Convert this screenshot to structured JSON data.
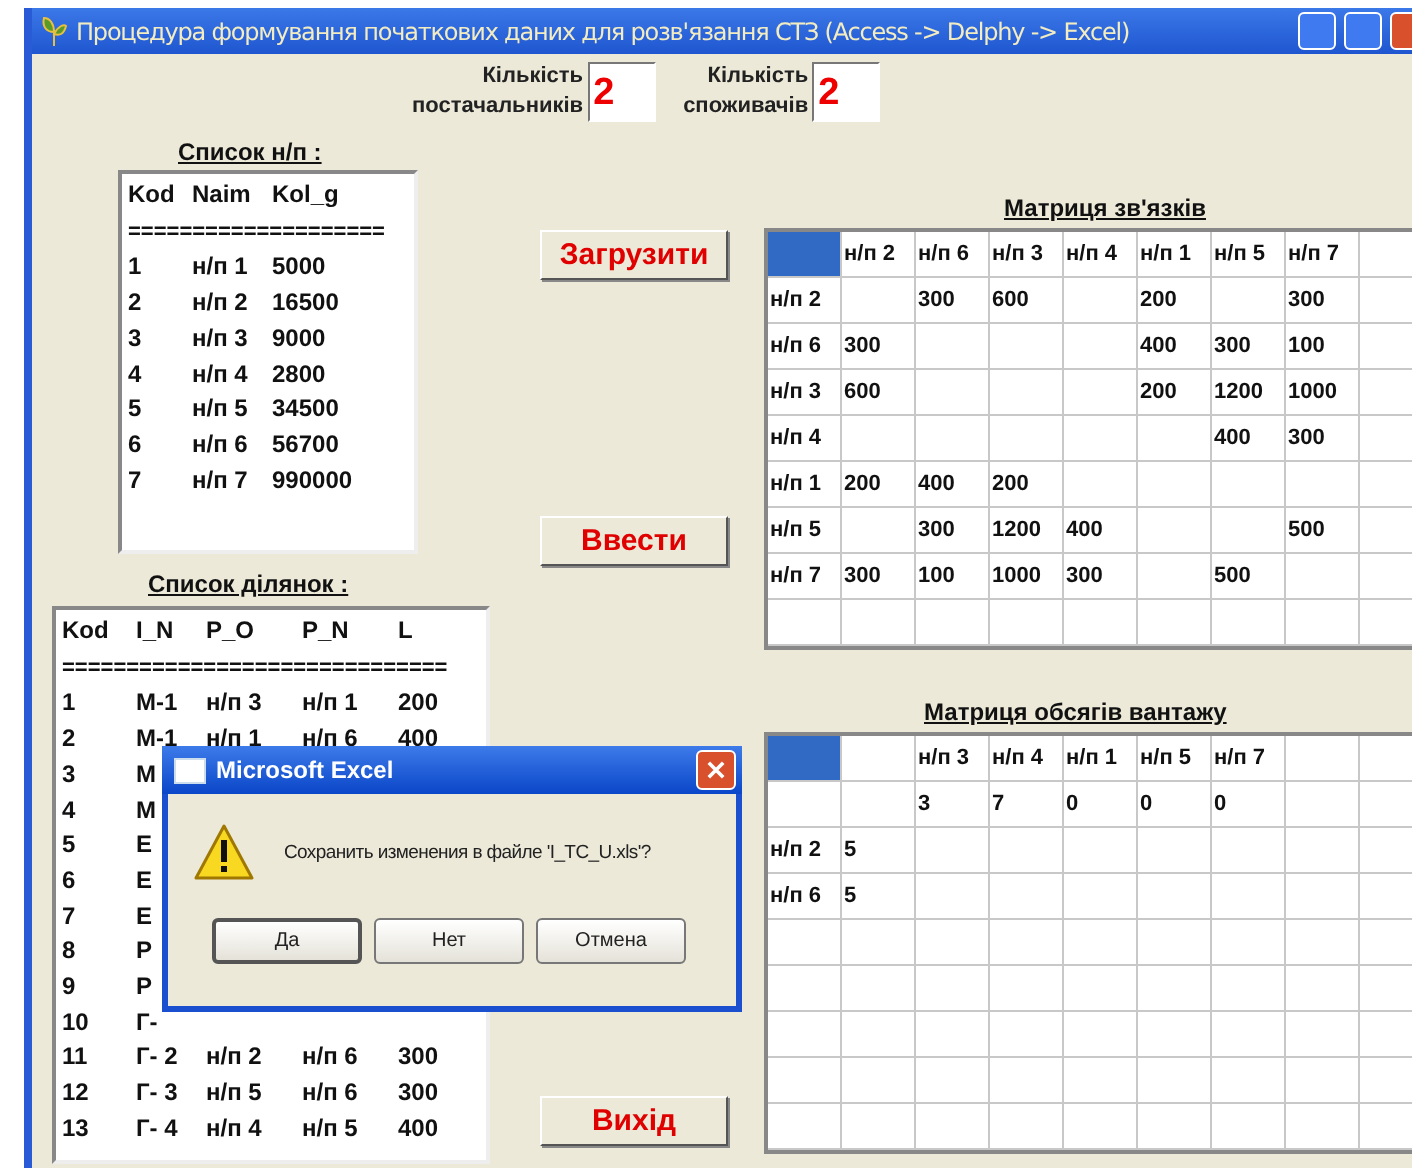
{
  "window": {
    "title": "Процедура формування початкових даних для розв'язання СТЗ (Access -> Delphy -> Excel)"
  },
  "counters": [
    {
      "label_lines": [
        "Кількість",
        "постачальників"
      ],
      "value": "2"
    },
    {
      "label_lines": [
        "Кількість",
        "споживачів"
      ],
      "value": "2"
    }
  ],
  "supplier_list": {
    "title": "Список н/п :",
    "header": [
      "Kod",
      "Naim",
      "Kol_g"
    ],
    "separator": "====================",
    "rows": [
      [
        "1",
        "н/п 1",
        "5000"
      ],
      [
        "2",
        "н/п 2",
        "16500"
      ],
      [
        "3",
        "н/п 3",
        "9000"
      ],
      [
        "4",
        "н/п 4",
        "2800"
      ],
      [
        "5",
        "н/п 5",
        "34500"
      ],
      [
        "6",
        "н/п 6",
        "56700"
      ],
      [
        "7",
        "н/п 7",
        "990000"
      ]
    ]
  },
  "section_list": {
    "title": "Список ділянок :",
    "header": [
      "Kod",
      "I_N",
      "P_O",
      "P_N",
      "L"
    ],
    "separator": "==============================",
    "rows": [
      [
        "1",
        "M-1",
        "н/п 3",
        "н/п 1",
        "200"
      ],
      [
        "2",
        "M-1",
        "н/п 1",
        "н/п 6",
        "400"
      ],
      [
        "3",
        "M"
      ],
      [
        "4",
        "M"
      ],
      [
        "5",
        "E"
      ],
      [
        "6",
        "E"
      ],
      [
        "7",
        "E"
      ],
      [
        "8",
        "P"
      ],
      [
        "9",
        "P"
      ],
      [
        "10",
        "Г-"
      ],
      [
        "11",
        "Г- 2",
        "н/п 2",
        "н/п 6",
        "300"
      ],
      [
        "12",
        "Г- 3",
        "н/п 5",
        "н/п 6",
        "300"
      ],
      [
        "13",
        "Г- 4",
        "н/п 4",
        "н/п 5",
        "400"
      ]
    ]
  },
  "buttons": [
    {
      "label": "Загрузити"
    },
    {
      "label": "Ввести"
    },
    {
      "label": "Вихід"
    }
  ],
  "link_matrix": {
    "title": "Матриця зв'язків",
    "corner_selected": true,
    "rows": [
      [
        null,
        "н/п 2",
        "н/п 6",
        "н/п 3",
        "н/п 4",
        "н/п 1",
        "н/п 5",
        "н/п 7",
        null
      ],
      [
        "н/п 2",
        null,
        "300",
        "600",
        null,
        "200",
        null,
        "300",
        null
      ],
      [
        "н/п 6",
        "300",
        null,
        null,
        null,
        "400",
        "300",
        "100",
        null
      ],
      [
        "н/п 3",
        "600",
        null,
        null,
        null,
        "200",
        "1200",
        "1000",
        null
      ],
      [
        "н/п 4",
        null,
        null,
        null,
        null,
        null,
        "400",
        "300",
        null
      ],
      [
        "н/п 1",
        "200",
        "400",
        "200",
        null,
        null,
        null,
        null,
        null
      ],
      [
        "н/п 5",
        null,
        "300",
        "1200",
        "400",
        null,
        null,
        "500",
        null
      ],
      [
        "н/п 7",
        "300",
        "100",
        "1000",
        "300",
        null,
        "500",
        null,
        null
      ],
      [
        null,
        null,
        null,
        null,
        null,
        null,
        null,
        null,
        null
      ]
    ]
  },
  "volume_matrix": {
    "title": "Матриця обсягів вантажу",
    "corner_selected": true,
    "rows": [
      [
        null,
        null,
        "н/п 3",
        "н/п 4",
        "н/п 1",
        "н/п 5",
        "н/п 7",
        null,
        null
      ],
      [
        null,
        null,
        "3",
        "7",
        "0",
        "0",
        "0",
        null,
        null
      ],
      [
        "н/п 2",
        "5",
        null,
        null,
        null,
        null,
        null,
        null,
        null
      ],
      [
        "н/п 6",
        "5",
        null,
        null,
        null,
        null,
        null,
        null,
        null
      ],
      [
        null,
        null,
        null,
        null,
        null,
        null,
        null,
        null,
        null
      ],
      [
        null,
        null,
        null,
        null,
        null,
        null,
        null,
        null,
        null
      ],
      [
        null,
        null,
        null,
        null,
        null,
        null,
        null,
        null,
        null
      ],
      [
        null,
        null,
        null,
        null,
        null,
        null,
        null,
        null,
        null
      ],
      [
        null,
        null,
        null,
        null,
        null,
        null,
        null,
        null,
        null
      ]
    ]
  },
  "dialog": {
    "title": "Microsoft Excel",
    "message": "Сохранить изменения в файле 'I_TC_U.xls'?",
    "buttons": [
      {
        "label": "Да",
        "focused": true
      },
      {
        "label": "Нет",
        "focused": false
      },
      {
        "label": "Отмена",
        "focused": false
      }
    ]
  }
}
